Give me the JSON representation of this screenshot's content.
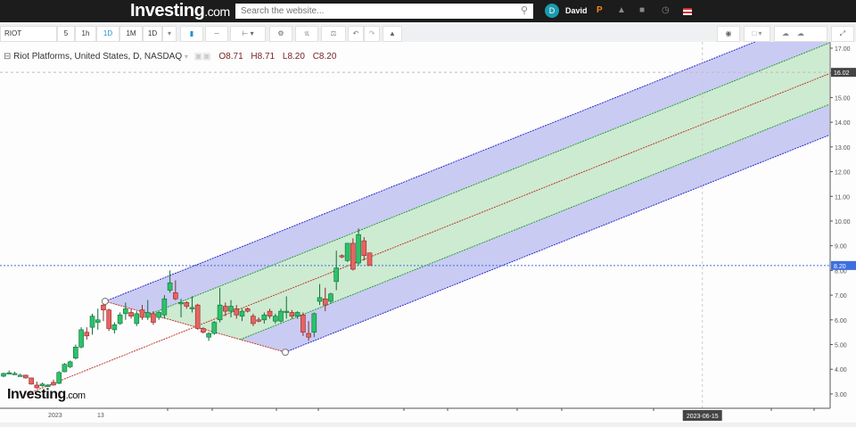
{
  "nav": {
    "logo": "Investing",
    "logo_suffix": ".com",
    "search_placeholder": "Search the website...",
    "avatar_letter": "D",
    "username": "David",
    "icons": [
      "search-icon",
      "pro-icon",
      "bell-icon",
      "briefcase-icon",
      "clock-icon",
      "us-flag-icon"
    ]
  },
  "toolbar": {
    "symbol": "RIOT",
    "intervals": [
      "5",
      "1h",
      "1D",
      "1M",
      "1D"
    ],
    "active_interval": "1D",
    "dropdown_arrow": "▾"
  },
  "legend": {
    "title": "Riot Platforms, United States, D, NASDAQ",
    "open": "O8.71",
    "high": "H8.71",
    "low": "L8.20",
    "close": "C8.20"
  },
  "colors": {
    "up": "#2bc26a",
    "down": "#e8635f",
    "channel_outer": "#c3c5f2",
    "channel_inner": "#cdeecd",
    "median": "#c0392b",
    "last_price": "#3d6fe0"
  },
  "chart_data": {
    "type": "candlestick",
    "title": "Riot Platforms, United States, D, NASDAQ",
    "ylim": [
      2.6,
      17.2
    ],
    "yticks": [
      "17.00",
      "16.00",
      "15.00",
      "14.00",
      "13.00",
      "12.00",
      "11.00",
      "10.00",
      "9.00",
      "8.00",
      "7.00",
      "6.00",
      "5.00",
      "4.00",
      "3.00"
    ],
    "last_price_label": "8.20",
    "last_price": 8.2,
    "marker_price_label": "16.02",
    "marker_price": 16.02,
    "xlabels": [
      {
        "bar": 9.3,
        "text": "2023"
      },
      {
        "bar": 17.5,
        "text": "13"
      }
    ],
    "crosshair_date": {
      "bar": 126,
      "text": "2023-06-15"
    },
    "candles": [
      [
        3.72,
        3.86,
        3.68,
        3.83
      ],
      [
        3.86,
        3.95,
        3.8,
        3.86
      ],
      [
        3.83,
        3.9,
        3.78,
        3.83
      ],
      [
        3.76,
        3.82,
        3.72,
        3.76
      ],
      [
        3.76,
        3.78,
        3.62,
        3.65
      ],
      [
        3.65,
        3.66,
        3.38,
        3.4
      ],
      [
        3.36,
        3.5,
        3.22,
        3.25
      ],
      [
        3.33,
        3.46,
        3.3,
        3.4
      ],
      [
        3.3,
        3.4,
        3.28,
        3.36
      ],
      [
        3.47,
        3.58,
        3.34,
        3.36
      ],
      [
        3.43,
        3.92,
        3.4,
        3.87
      ],
      [
        3.9,
        4.25,
        3.88,
        4.2
      ],
      [
        4.1,
        4.35,
        4.05,
        4.3
      ],
      [
        4.45,
        5.0,
        4.4,
        4.9
      ],
      [
        4.9,
        5.7,
        4.85,
        5.6
      ],
      [
        5.5,
        5.7,
        5.2,
        5.35
      ],
      [
        5.7,
        6.25,
        5.4,
        6.15
      ],
      [
        5.9,
        6.45,
        5.6,
        6.0
      ],
      [
        6.6,
        6.85,
        5.95,
        6.4
      ],
      [
        6.4,
        6.45,
        5.55,
        5.65
      ],
      [
        5.6,
        5.9,
        5.45,
        5.8
      ],
      [
        5.85,
        6.3,
        5.8,
        6.2
      ],
      [
        6.25,
        6.7,
        6.0,
        6.45
      ],
      [
        6.3,
        6.45,
        6.05,
        6.15
      ],
      [
        5.85,
        6.35,
        5.75,
        6.25
      ],
      [
        6.4,
        6.6,
        6.0,
        6.1
      ],
      [
        6.1,
        6.8,
        6.0,
        6.3
      ],
      [
        6.25,
        6.35,
        5.8,
        5.9
      ],
      [
        6.1,
        6.35,
        6.0,
        6.3
      ],
      [
        6.2,
        7.0,
        6.05,
        6.85
      ],
      [
        7.2,
        8.0,
        7.1,
        7.5
      ],
      [
        7.1,
        7.6,
        6.8,
        6.85
      ],
      [
        6.7,
        6.85,
        6.1,
        6.7
      ],
      [
        6.7,
        6.75,
        6.45,
        6.55
      ],
      [
        6.5,
        6.95,
        6.3,
        6.5
      ],
      [
        6.6,
        6.65,
        5.6,
        5.65
      ],
      [
        5.65,
        5.7,
        5.45,
        5.5
      ],
      [
        5.3,
        5.5,
        5.15,
        5.45
      ],
      [
        5.45,
        5.95,
        5.4,
        5.9
      ],
      [
        6.0,
        7.3,
        5.9,
        6.6
      ],
      [
        6.55,
        6.7,
        6.15,
        6.35
      ],
      [
        6.35,
        6.8,
        6.1,
        6.55
      ],
      [
        6.45,
        6.6,
        6.05,
        6.2
      ],
      [
        6.15,
        6.45,
        5.95,
        6.35
      ],
      [
        6.45,
        6.5,
        6.3,
        6.35
      ],
      [
        6.15,
        6.25,
        5.75,
        5.85
      ],
      [
        6.0,
        6.1,
        5.9,
        5.95
      ],
      [
        6.0,
        6.3,
        5.85,
        6.2
      ],
      [
        6.35,
        6.45,
        6.05,
        6.15
      ],
      [
        5.95,
        6.25,
        5.85,
        6.15
      ],
      [
        5.95,
        6.45,
        5.9,
        6.35
      ],
      [
        6.35,
        6.95,
        6.05,
        6.35
      ],
      [
        6.3,
        6.4,
        6.05,
        6.15
      ],
      [
        6.15,
        6.35,
        6.05,
        6.3
      ],
      [
        6.2,
        6.3,
        5.35,
        5.5
      ],
      [
        5.45,
        5.95,
        5.15,
        5.3
      ],
      [
        5.5,
        6.3,
        5.3,
        6.25
      ],
      [
        6.75,
        7.45,
        6.6,
        6.9
      ],
      [
        6.85,
        7.3,
        6.35,
        6.6
      ],
      [
        6.75,
        7.1,
        6.65,
        7.05
      ],
      [
        7.55,
        8.8,
        7.2,
        8.1
      ],
      [
        8.6,
        8.65,
        8.5,
        8.55
      ],
      [
        8.4,
        9.1,
        8.35,
        9.1
      ],
      [
        9.1,
        9.3,
        8.0,
        8.05
      ],
      [
        8.3,
        9.7,
        8.2,
        9.45
      ],
      [
        9.2,
        9.35,
        8.4,
        8.6
      ],
      [
        8.71,
        8.71,
        8.2,
        8.2
      ]
    ],
    "pitchfork": {
      "pivot": {
        "bar": 4.2,
        "price": 3.0
      },
      "handle_upper": {
        "bar": 18.3,
        "price": 6.75
      },
      "handle_lower": {
        "bar": 50.8,
        "price": 4.69
      },
      "inner_ratio": 0.5
    }
  }
}
